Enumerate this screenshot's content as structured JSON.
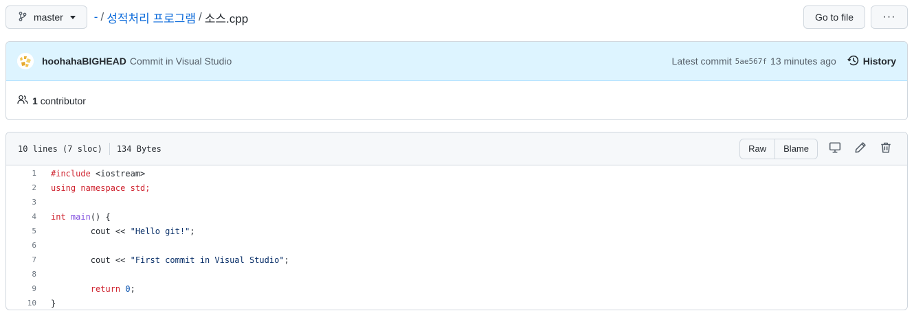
{
  "branch": {
    "name": "master"
  },
  "breadcrumb": {
    "repo_link": "-",
    "folder": "성적처리 프로그램",
    "file": "소스.cpp",
    "sep": "/"
  },
  "top_actions": {
    "go_to_file": "Go to file",
    "more": "···"
  },
  "commit": {
    "author": "hoohahaBIGHEAD",
    "message": "Commit in Visual Studio",
    "latest_label": "Latest commit",
    "sha": "5ae567f",
    "time": "13 minutes ago",
    "history_label": "History"
  },
  "contributors": {
    "count": "1",
    "label": "contributor"
  },
  "file": {
    "lines": "10 lines (7 sloc)",
    "size": "134 Bytes",
    "raw_label": "Raw",
    "blame_label": "Blame"
  },
  "code_lines": [
    {
      "n": "1",
      "tokens": [
        {
          "t": "#include",
          "c": "kw"
        },
        {
          "t": " <iostream>",
          "c": ""
        }
      ]
    },
    {
      "n": "2",
      "tokens": [
        {
          "t": "using namespace std;",
          "c": "kw"
        }
      ]
    },
    {
      "n": "3",
      "tokens": []
    },
    {
      "n": "4",
      "tokens": [
        {
          "t": "int",
          "c": "kw"
        },
        {
          "t": " ",
          "c": ""
        },
        {
          "t": "main",
          "c": "fn"
        },
        {
          "t": "() {",
          "c": ""
        }
      ]
    },
    {
      "n": "5",
      "tokens": [
        {
          "t": "        cout << ",
          "c": ""
        },
        {
          "t": "\"Hello git!\"",
          "c": "str"
        },
        {
          "t": ";",
          "c": ""
        }
      ]
    },
    {
      "n": "6",
      "tokens": []
    },
    {
      "n": "7",
      "tokens": [
        {
          "t": "        cout << ",
          "c": ""
        },
        {
          "t": "\"First commit in Visual Studio\"",
          "c": "str"
        },
        {
          "t": ";",
          "c": ""
        }
      ]
    },
    {
      "n": "8",
      "tokens": []
    },
    {
      "n": "9",
      "tokens": [
        {
          "t": "        ",
          "c": ""
        },
        {
          "t": "return",
          "c": "kw"
        },
        {
          "t": " ",
          "c": ""
        },
        {
          "t": "0",
          "c": "num"
        },
        {
          "t": ";",
          "c": ""
        }
      ]
    },
    {
      "n": "10",
      "tokens": [
        {
          "t": "}",
          "c": ""
        }
      ]
    }
  ],
  "icons": {
    "branch": "git-branch-icon",
    "history": "history-icon",
    "people": "people-icon",
    "display": "desktop-icon",
    "edit": "pencil-icon",
    "delete": "trash-icon"
  }
}
